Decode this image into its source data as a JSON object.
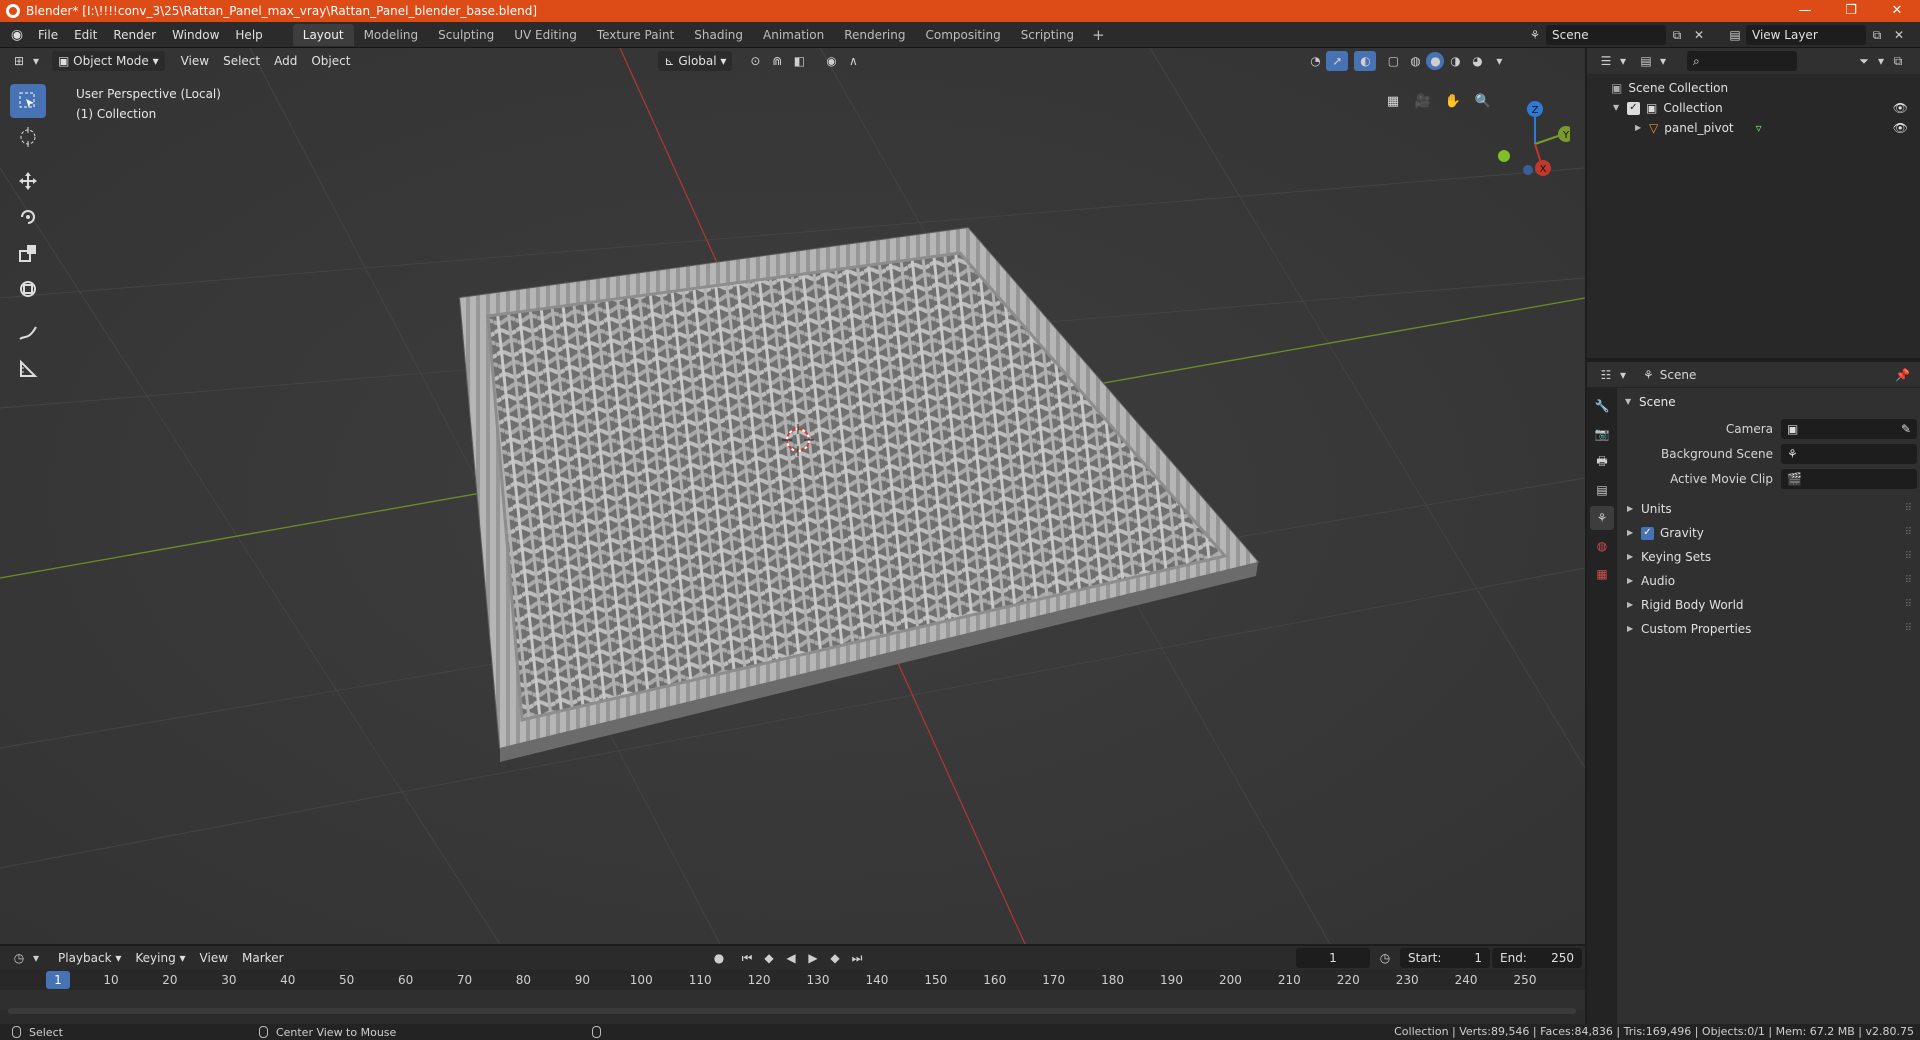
{
  "window": {
    "title": "Blender* [I:\\!!!!conv_3\\25\\Rattan_Panel_max_vray\\Rattan_Panel_blender_base.blend]",
    "minimize": "—",
    "maximize": "❐",
    "close": "✕"
  },
  "menubar": {
    "items": [
      "File",
      "Edit",
      "Render",
      "Window",
      "Help"
    ],
    "workspaces": [
      "Layout",
      "Modeling",
      "Sculpting",
      "UV Editing",
      "Texture Paint",
      "Shading",
      "Animation",
      "Rendering",
      "Compositing",
      "Scripting"
    ],
    "active_workspace": "Layout",
    "add_workspace": "+",
    "scene_name": "Scene",
    "view_layer_name": "View Layer"
  },
  "viewport": {
    "mode": "Object Mode",
    "menus": [
      "View",
      "Select",
      "Add",
      "Object"
    ],
    "transform_orientation": "Global",
    "info_line1": "User Perspective (Local)",
    "info_line2": "(1) Collection",
    "gizmo": {
      "x": "X",
      "y": "Y",
      "z": "Z"
    }
  },
  "outliner": {
    "search_placeholder": "",
    "root": "Scene Collection",
    "collection": "Collection",
    "object": "panel_pivot"
  },
  "properties": {
    "header_title": "Scene",
    "panel_title": "Scene",
    "camera_label": "Camera",
    "background_scene_label": "Background Scene",
    "active_movie_clip_label": "Active Movie Clip",
    "sub_panels": [
      "Units",
      "Gravity",
      "Keying Sets",
      "Audio",
      "Rigid Body World",
      "Custom Properties"
    ],
    "gravity_checked": true
  },
  "timeline": {
    "menus": [
      "Playback",
      "Keying",
      "View",
      "Marker"
    ],
    "current_frame": "1",
    "start_label": "Start:",
    "start_value": "1",
    "end_label": "End:",
    "end_value": "250",
    "ticks": [
      "1",
      "10",
      "20",
      "30",
      "40",
      "50",
      "60",
      "70",
      "80",
      "90",
      "100",
      "110",
      "120",
      "130",
      "140",
      "150",
      "160",
      "170",
      "180",
      "190",
      "200",
      "210",
      "220",
      "230",
      "240",
      "250"
    ]
  },
  "statusbar": {
    "left_action": "Select",
    "middle_action": "Center View to Mouse",
    "stats": "Collection | Verts:89,546 | Faces:84,836 | Tris:169,496 | Objects:0/1 | Mem: 67.2 MB | v2.80.75"
  },
  "colors": {
    "accent": "#4772b3",
    "titlebar": "#dd4b16",
    "viewport_bg": "#393939",
    "x_axis": "#c0392b",
    "y_axis": "#7a9a2a",
    "z_axis": "#2e7bd6"
  }
}
